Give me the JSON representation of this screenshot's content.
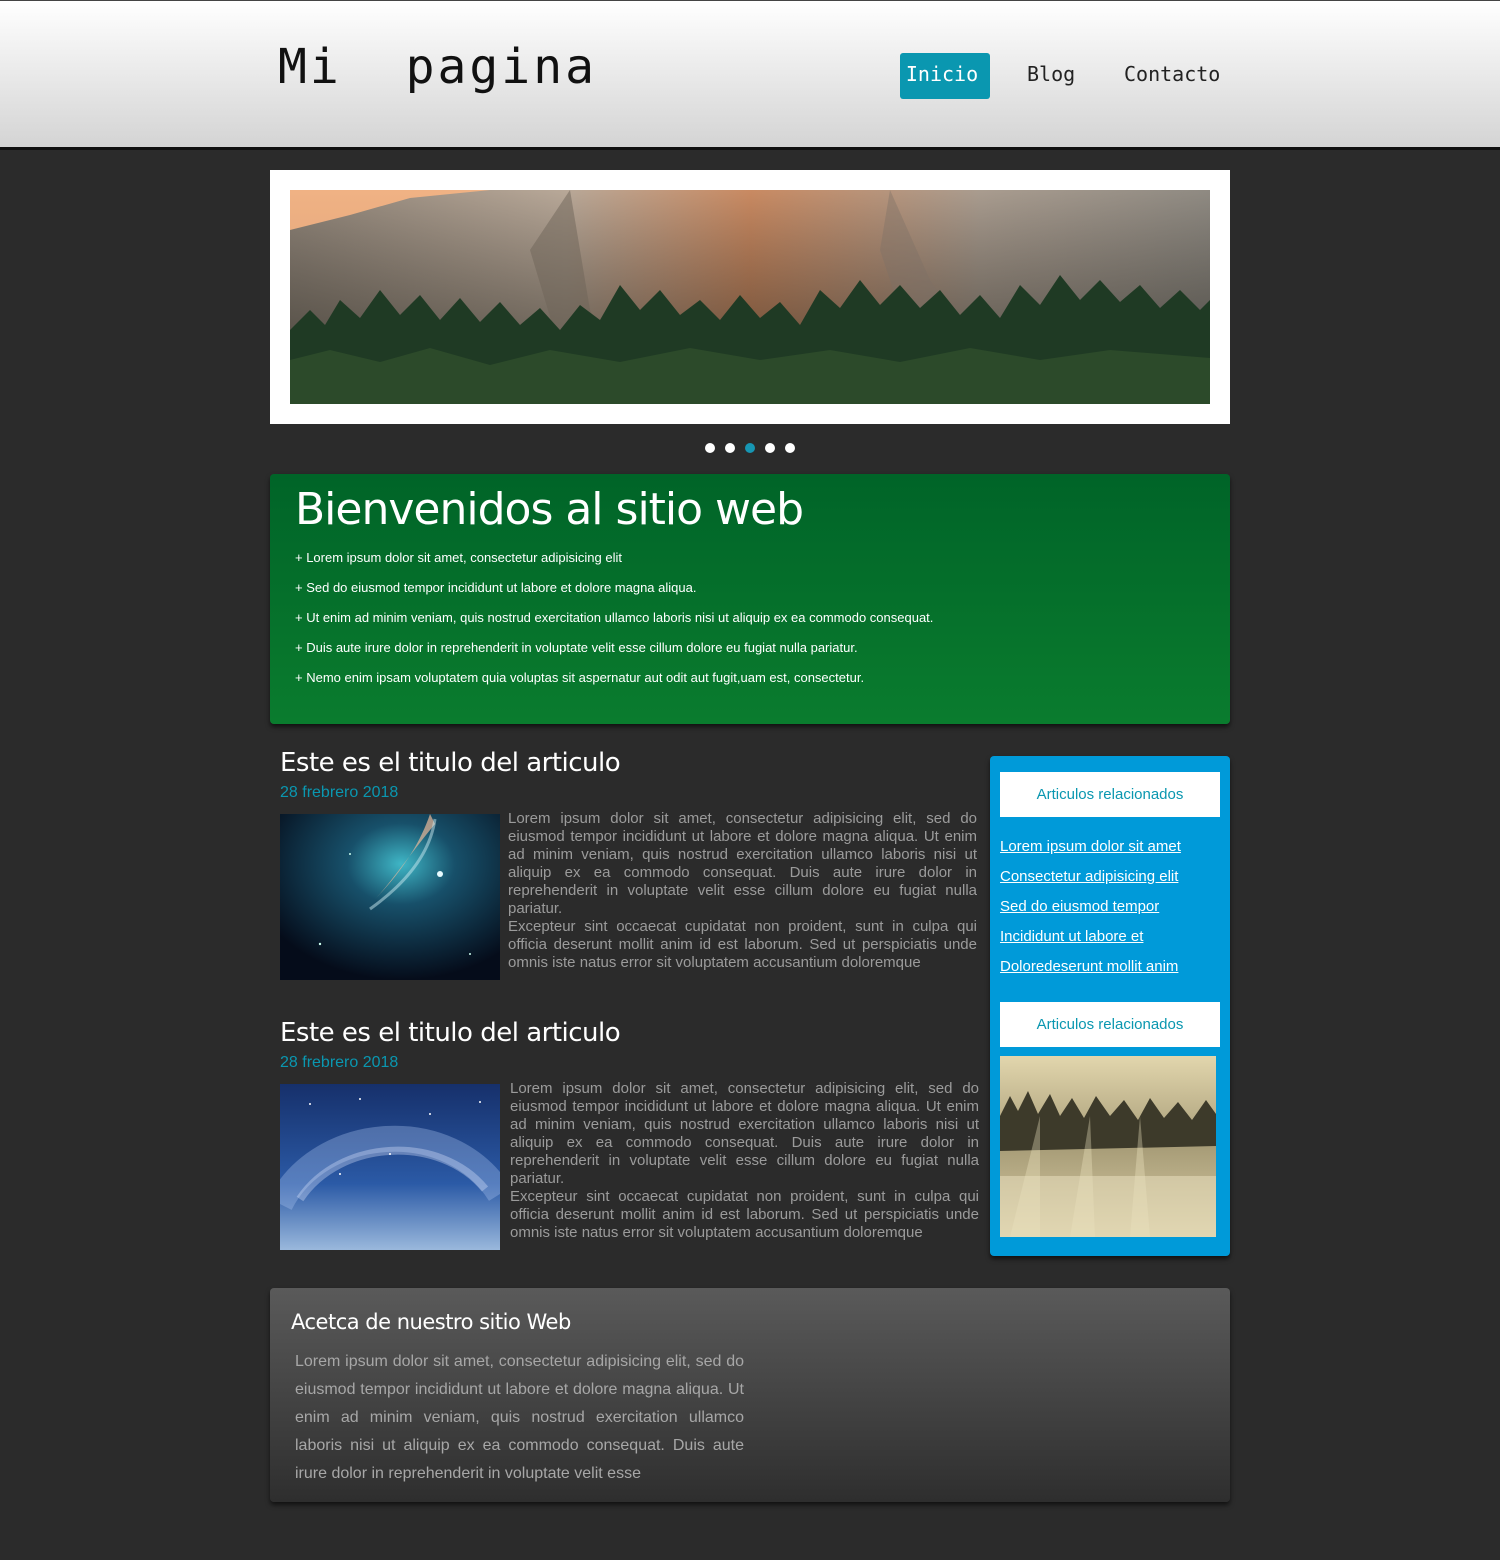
{
  "header": {
    "logo": "Mi  pagina",
    "nav": [
      {
        "label": "Inicio",
        "active": true
      },
      {
        "label": "Blog",
        "active": false
      },
      {
        "label": "Contacto",
        "active": false
      }
    ]
  },
  "slider": {
    "image": "yosemite-cliff-forest-photo",
    "slide_count": 5,
    "active_slide": 3
  },
  "welcome": {
    "title": "Bienvenidos al sitio web",
    "items": [
      "+ Lorem ipsum dolor sit amet, consectetur adipisicing elit",
      "+ Sed do eiusmod tempor incididunt ut labore et dolore magna aliqua.",
      "+ Ut enim ad minim veniam, quis nostrud exercitation ullamco laboris nisi ut aliquip ex ea commodo consequat.",
      "+ Duis aute irure dolor in reprehenderit in voluptate velit esse cillum dolore eu fugiat nulla pariatur.",
      "+ Nemo enim ipsam voluptatem quia voluptas sit aspernatur aut odit aut fugit,uam est, consectetur."
    ]
  },
  "articles": [
    {
      "title": "Este es el titulo del articulo",
      "date": "28 frebrero 2018",
      "image": "nebula-space-photo",
      "paragraph1": "Lorem ipsum dolor sit amet, consectetur adipisicing elit, sed do eiusmod tempor incididunt ut labore et dolore magna aliqua. Ut enim ad minim veniam, quis nostrud exercitation ullamco laboris nisi ut aliquip ex ea commodo consequat. Duis aute irure dolor in reprehenderit in voluptate velit esse cillum dolore eu fugiat nulla pariatur.",
      "paragraph2": "Excepteur sint occaecat cupidatat non proident, sunt in culpa qui officia deserunt mollit anim id est laborum. Sed ut perspiciatis unde omnis iste natus error sit voluptatem accusantium doloremque"
    },
    {
      "title": "Este es el titulo del articulo",
      "date": "28 frebrero 2018",
      "image": "milky-way-night-sky-photo",
      "paragraph1": "Lorem ipsum dolor sit amet, consectetur adipisicing elit, sed do eiusmod tempor incididunt ut labore et dolore magna aliqua. Ut enim ad minim veniam, quis nostrud exercitation ullamco laboris nisi ut aliquip ex ea commodo consequat. Duis aute irure dolor in reprehenderit in voluptate velit esse cillum dolore eu fugiat nulla pariatur.",
      "paragraph2": "Excepteur sint occaecat cupidatat non proident, sunt in culpa qui officia deserunt mollit anim id est laborum. Sed ut perspiciatis unde omnis iste natus error sit voluptatem accusantium doloremque"
    }
  ],
  "sidebar": {
    "heading1": "Articulos relacionados",
    "links": [
      "Lorem ipsum dolor sit amet",
      "Consectetur adipisicing elit",
      "Sed do eiusmod tempor",
      "Incididunt ut labore et ",
      "Doloredeserunt mollit anim"
    ],
    "heading2": "Articulos relacionados",
    "image": "misty-forest-sunrays-photo"
  },
  "about": {
    "title": "Acetca de nuestro sitio Web",
    "text": "Lorem ipsum dolor sit amet, consectetur adipisicing elit, sed do eiusmod tempor incididunt ut labore et dolore magna aliqua. Ut enim ad minim veniam, quis nostrud exercitation ullamco laboris nisi ut aliquip ex ea commodo consequat. Duis aute irure dolor in reprehenderit in voluptate velit esse"
  },
  "colors": {
    "accent": "#0a97b0",
    "page_bg": "#2b2b2b",
    "welcome_bg": "#006428",
    "sidebar_bg": "#009ad9"
  }
}
